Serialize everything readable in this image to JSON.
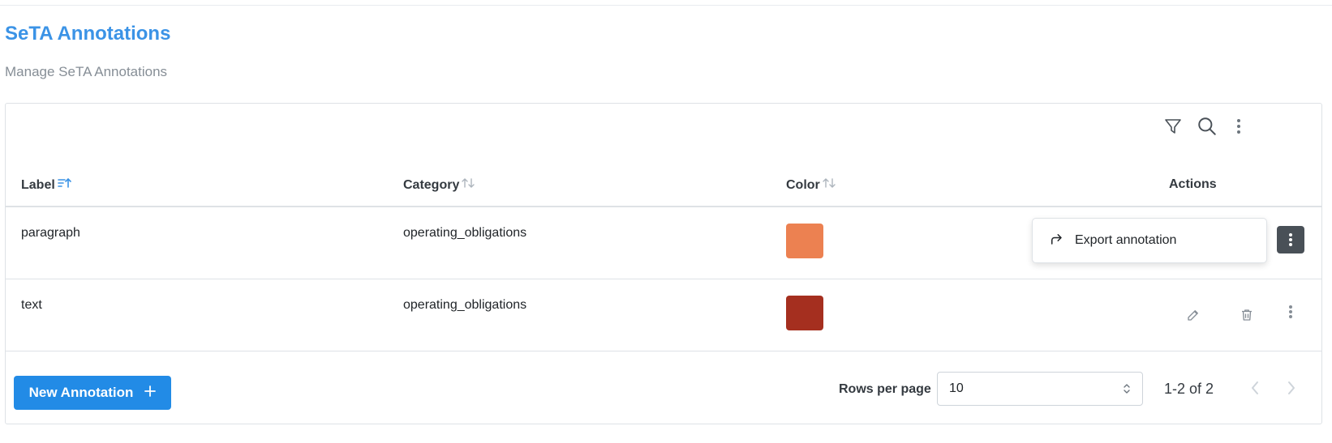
{
  "header": {
    "title": "SeTA Annotations",
    "subtitle": "Manage SeTA Annotations"
  },
  "toolbar": {
    "icons": [
      "filter-icon",
      "search-icon",
      "more-vertical-icon"
    ]
  },
  "table": {
    "columns": [
      {
        "label": "Label",
        "sort": "ascending"
      },
      {
        "label": "Category",
        "sort": "none"
      },
      {
        "label": "Color",
        "sort": "none"
      },
      {
        "label": "Actions"
      }
    ],
    "rows": [
      {
        "label": "paragraph",
        "category": "operating_obligations",
        "color": "#ec8151"
      },
      {
        "label": "text",
        "category": "operating_obligations",
        "color": "#a52f1f"
      }
    ]
  },
  "context_menu": {
    "item_label": "Export annotation",
    "icon": "share-arrow-icon"
  },
  "row_actions": {
    "icons": [
      "edit-icon",
      "trash-icon",
      "more-vertical-icon"
    ]
  },
  "footer": {
    "new_button_label": "New Annotation",
    "rows_per_page_label": "Rows per page",
    "rows_per_page_value": "10",
    "page_report": "1-2 of 2"
  },
  "colors": {
    "accent": "#228be6",
    "title": "#3b93e6",
    "dark_button": "#495057"
  }
}
